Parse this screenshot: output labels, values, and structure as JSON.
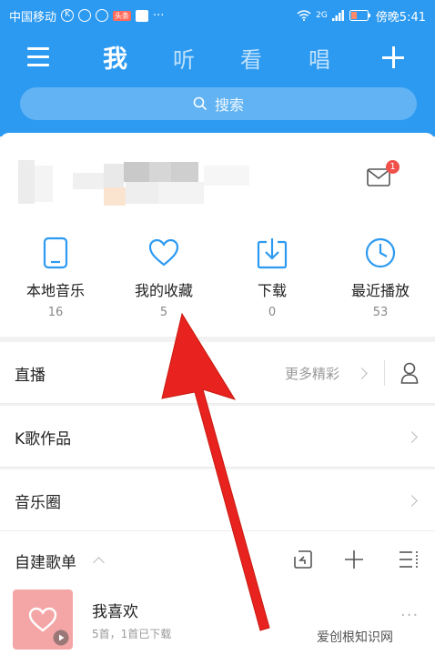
{
  "status": {
    "carrier": "中国移动",
    "time": "傍晚5:41",
    "network": "2G",
    "notif_badge": "头条"
  },
  "nav": {
    "tabs": [
      {
        "label": "我"
      },
      {
        "label": "听"
      },
      {
        "label": "看"
      },
      {
        "label": "唱"
      }
    ]
  },
  "search": {
    "placeholder": "搜索"
  },
  "profile": {
    "mail_badge": "1"
  },
  "quick": [
    {
      "label": "本地音乐",
      "count": "16",
      "icon": "phone-icon"
    },
    {
      "label": "我的收藏",
      "count": "5",
      "icon": "heart-icon"
    },
    {
      "label": "下载",
      "count": "0",
      "icon": "download-icon"
    },
    {
      "label": "最近播放",
      "count": "53",
      "icon": "clock-icon"
    }
  ],
  "rows": {
    "live": "直播",
    "live_more": "更多精彩",
    "k_song": "K歌作品",
    "music_circle": "音乐圈"
  },
  "playlists": {
    "title": "自建歌单",
    "song_title": "我喜欢",
    "song_subtitle": "5首，1首已下载"
  },
  "watermark": "爱创根知识网",
  "colors": {
    "brand": "#2c9af1",
    "badge": "#f0504a",
    "arrow": "#e8231f"
  }
}
